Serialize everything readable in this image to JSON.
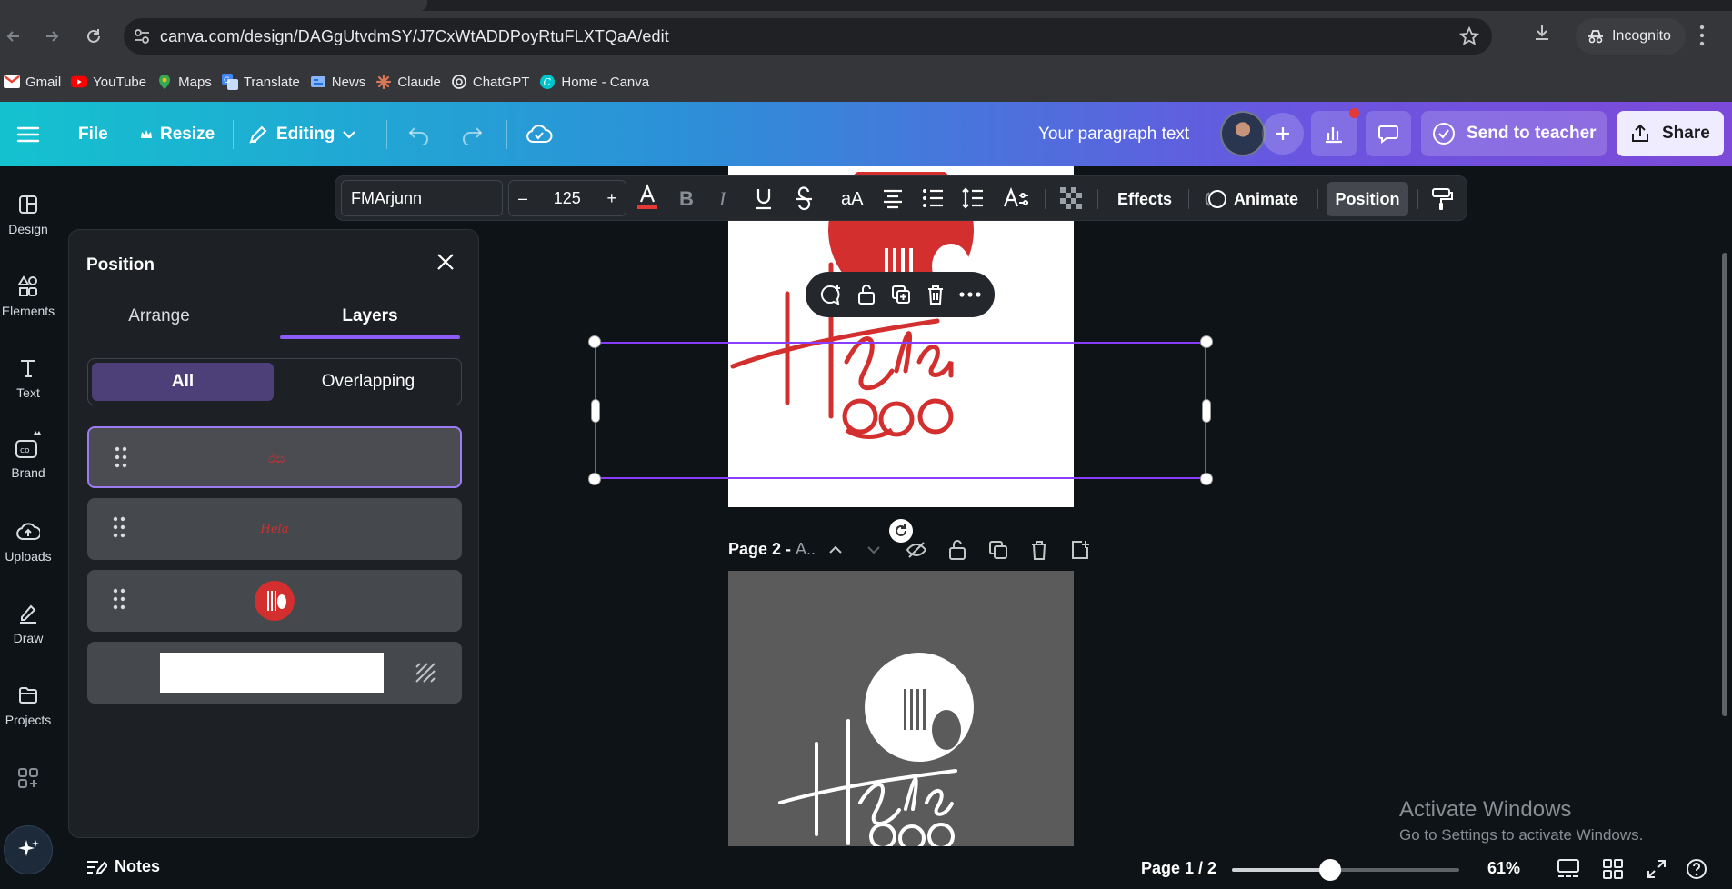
{
  "browser": {
    "url": "canva.com/design/DAGgUtvdmSY/J7CxWtADDPoyRtuFLXTQaA/edit",
    "profile_label": "Incognito",
    "bookmarks": [
      {
        "label": "Gmail",
        "icon": "gmail-icon",
        "color": "#ea4335"
      },
      {
        "label": "YouTube",
        "icon": "youtube-icon",
        "color": "#ff0000"
      },
      {
        "label": "Maps",
        "icon": "maps-icon",
        "color": "#34a853"
      },
      {
        "label": "Translate",
        "icon": "translate-icon",
        "color": "#4285f4"
      },
      {
        "label": "News",
        "icon": "news-icon",
        "color": "#8ab4f8"
      },
      {
        "label": "Claude",
        "icon": "claude-icon",
        "color": "#d97757"
      },
      {
        "label": "ChatGPT",
        "icon": "chatgpt-icon",
        "color": "#e8eaed"
      },
      {
        "label": "Home - Canva",
        "icon": "canva-icon",
        "color": "#00c4cc"
      }
    ]
  },
  "topbar": {
    "file_label": "File",
    "resize_label": "Resize",
    "editing_label": "Editing",
    "doc_title": "Your paragraph text",
    "send_label": "Send to teacher",
    "share_label": "Share"
  },
  "rail": [
    {
      "label": "Design",
      "icon": "design-icon"
    },
    {
      "label": "Elements",
      "icon": "elements-icon"
    },
    {
      "label": "Text",
      "icon": "text-icon"
    },
    {
      "label": "Brand",
      "icon": "brand-icon"
    },
    {
      "label": "Uploads",
      "icon": "uploads-icon"
    },
    {
      "label": "Draw",
      "icon": "draw-icon"
    },
    {
      "label": "Projects",
      "icon": "projects-icon"
    }
  ],
  "text_toolbar": {
    "font": "FMArjunn",
    "size": "125",
    "minus": "–",
    "plus": "+",
    "effects_label": "Effects",
    "animate_label": "Animate",
    "position_label": "Position",
    "aa_label": "aA"
  },
  "panel": {
    "title": "Position",
    "tab_arrange": "Arrange",
    "tab_layers": "Layers",
    "seg_all": "All",
    "seg_overlapping": "Overlapping",
    "layers": [
      {
        "name": "sinhala-text-layer",
        "selected": true,
        "thumb_text": "රස"
      },
      {
        "name": "hela-text-layer",
        "selected": false,
        "thumb_text": "Hela"
      },
      {
        "name": "logo-circle-layer",
        "selected": false
      },
      {
        "name": "background-layer",
        "selected": false
      }
    ]
  },
  "canvas": {
    "page1_word": "Hela",
    "page1_sinhala": "රස",
    "page2_label_strong": "Page 2 - ",
    "page2_label_dim": "A..",
    "page2_word": "Hela",
    "page2_sinhala": "රස",
    "brand_red": "#d32f2f"
  },
  "watermark": {
    "line1": "Activate Windows",
    "line2": "Go to Settings to activate Windows."
  },
  "footer": {
    "notes_label": "Notes",
    "page_info": "Page 1 / 2",
    "zoom_pct": "61%",
    "zoom_fraction": 0.43
  }
}
